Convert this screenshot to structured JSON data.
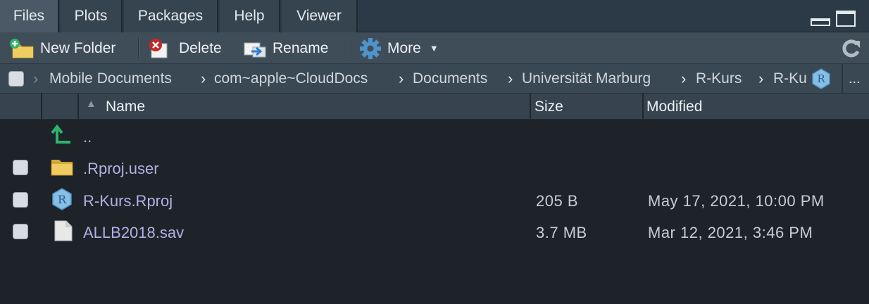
{
  "tabs": [
    {
      "label": "Files",
      "active": true
    },
    {
      "label": "Plots"
    },
    {
      "label": "Packages"
    },
    {
      "label": "Help"
    },
    {
      "label": "Viewer"
    }
  ],
  "toolbar": {
    "new_folder": "New Folder",
    "delete": "Delete",
    "rename": "Rename",
    "more": "More"
  },
  "breadcrumb": [
    "Mobile Documents",
    "com~apple~CloudDocs",
    "Documents",
    "Universität Marburg",
    "R-Kurs",
    "R-Ku"
  ],
  "breadcrumb_more": "...",
  "columns": {
    "name": "Name",
    "size": "Size",
    "modified": "Modified"
  },
  "files": [
    {
      "name": "..",
      "size": "",
      "modified": "",
      "type": "parent"
    },
    {
      "name": ".Rproj.user",
      "size": "",
      "modified": "",
      "type": "folder"
    },
    {
      "name": "R-Kurs.Rproj",
      "size": "205 B",
      "modified": "May 17, 2021, 10:00 PM",
      "type": "rproj"
    },
    {
      "name": "ALLB2018.sav",
      "size": "3.7 MB",
      "modified": "Mar 12, 2021, 3:46 PM",
      "type": "file"
    }
  ],
  "colors": {
    "file_link": "#b3b0e6",
    "background": "#1d2328",
    "accent_green": "#2fb36b"
  }
}
